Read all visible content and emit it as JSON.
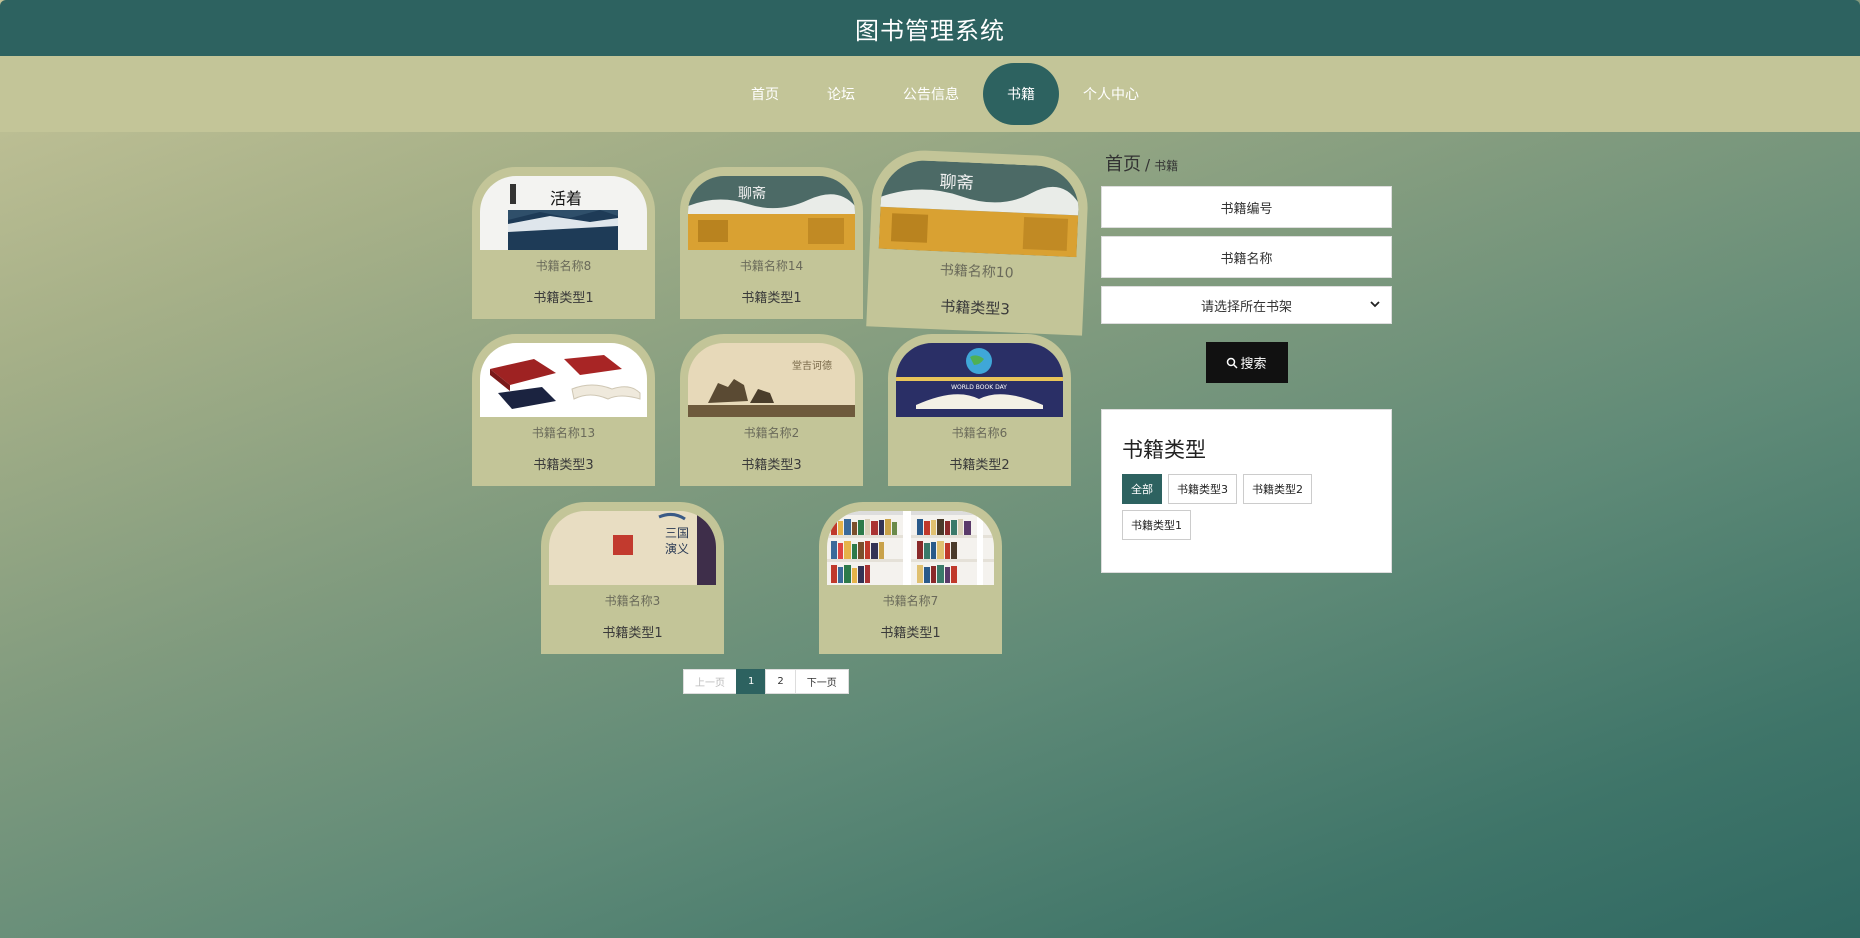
{
  "header": {
    "title": "图书管理系统"
  },
  "nav": {
    "items": [
      {
        "label": "首页"
      },
      {
        "label": "论坛"
      },
      {
        "label": "公告信息"
      },
      {
        "label": "书籍"
      },
      {
        "label": "个人中心"
      }
    ],
    "active": "书籍"
  },
  "books": [
    {
      "name": "书籍名称8",
      "type": "书籍类型1"
    },
    {
      "name": "书籍名称14",
      "type": "书籍类型1"
    },
    {
      "name": "书籍名称10",
      "type": "书籍类型3"
    },
    {
      "name": "书籍名称13",
      "type": "书籍类型3"
    },
    {
      "name": "书籍名称2",
      "type": "书籍类型3"
    },
    {
      "name": "书籍名称6",
      "type": "书籍类型2"
    },
    {
      "name": "书籍名称3",
      "type": "书籍类型1"
    },
    {
      "name": "书籍名称7",
      "type": "书籍类型1"
    }
  ],
  "pagination": {
    "prev": "上一页",
    "pages": [
      "1",
      "2"
    ],
    "current": "1",
    "next": "下一页"
  },
  "sidebar": {
    "breadcrumb": {
      "home": "首页",
      "separator": "/",
      "current": "书籍"
    },
    "book_no_placeholder": "书籍编号",
    "book_name_placeholder": "书籍名称",
    "shelf_select": "请选择所在书架",
    "search_label": "搜索",
    "type_heading": "书籍类型",
    "types": [
      "全部",
      "书籍类型3",
      "书籍类型2",
      "书籍类型1"
    ],
    "active_type": "全部"
  },
  "colors": {
    "primary": "#2d6260",
    "nav_bg": "#c3c598",
    "card_bg": "#c3c598"
  }
}
